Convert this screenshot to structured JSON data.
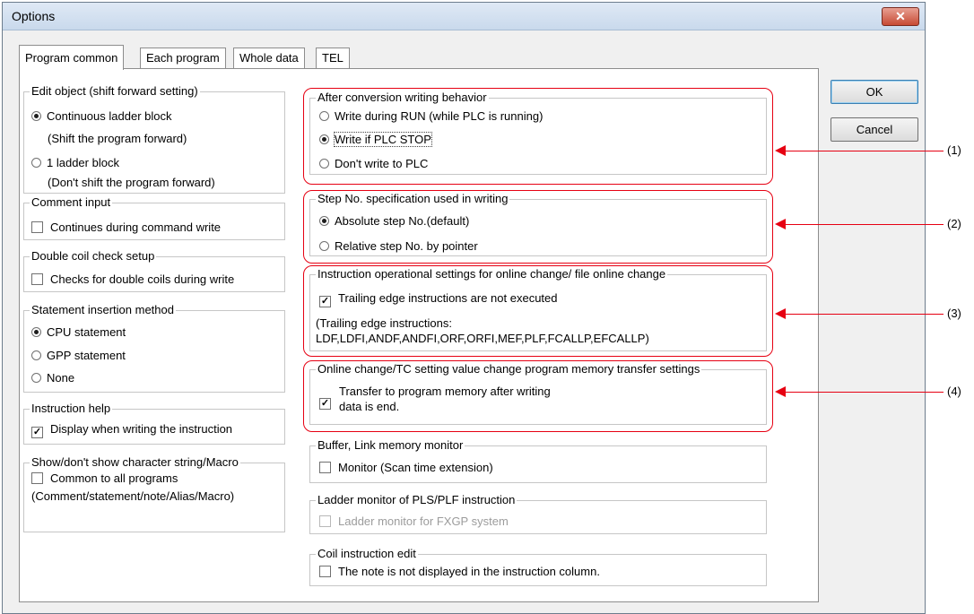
{
  "window": {
    "title": "Options",
    "close_glyph": "✕"
  },
  "tabs": [
    "Program common",
    "Each program",
    "Whole data",
    "TEL"
  ],
  "buttons": {
    "ok": "OK",
    "cancel": "Cancel"
  },
  "left": {
    "edit_object": {
      "legend": "Edit object (shift forward setting)",
      "opt1": "Continuous ladder block",
      "opt1_sub": "(Shift the program forward)",
      "opt2": "1 ladder block",
      "opt2_sub": "(Don't shift the program forward)",
      "selected": 1
    },
    "comment_input": {
      "legend": "Comment input",
      "opt": "Continues during command write",
      "checked": false
    },
    "double_coil": {
      "legend": "Double coil check setup",
      "opt": "Checks for double coils during write",
      "checked": false
    },
    "statement_insertion": {
      "legend": "Statement insertion method",
      "opts": [
        "CPU statement",
        "GPP statement",
        "None"
      ],
      "selected": 1
    },
    "instruction_help": {
      "legend": "Instruction help",
      "opt": "Display when writing the instruction",
      "checked": true
    },
    "show_string": {
      "legend": "Show/don't show character string/Macro",
      "opt": "Common to all programs",
      "sub": "(Comment/statement/note/Alias/Macro)",
      "checked": false
    }
  },
  "right": {
    "after_conversion": {
      "legend": "After conversion writing behavior",
      "opts": [
        "Write during RUN (while PLC is running)",
        "Write if PLC STOP",
        "Don't write to PLC"
      ],
      "selected": 2
    },
    "step_no": {
      "legend": "Step No. specification used in writing",
      "opts": [
        "Absolute step No.(default)",
        "Relative step No. by pointer"
      ],
      "selected": 1
    },
    "instruction_operational": {
      "legend": "Instruction operational settings for online change/ file online change",
      "opt": "Trailing edge instructions are not executed",
      "checked": true,
      "note1": "(Trailing edge instructions:",
      "note2": "LDF,LDFI,ANDF,ANDFI,ORF,ORFI,MEF,PLF,FCALLP,EFCALLP)"
    },
    "online_change": {
      "legend": "Online change/TC setting value change program memory transfer settings",
      "opt_line1": "Transfer to program memory after writing",
      "opt_line2": "data is end.",
      "checked": true
    },
    "buffer_link": {
      "legend": "Buffer, Link memory monitor",
      "opt": "Monitor (Scan time extension)",
      "checked": false
    },
    "ladder_monitor": {
      "legend": "Ladder monitor of PLS/PLF instruction",
      "opt": "Ladder monitor for FXGP system",
      "checked": false,
      "disabled": true
    },
    "coil_edit": {
      "legend": "Coil instruction edit",
      "opt": "The note is not displayed in the instruction column.",
      "checked": false
    }
  },
  "callouts": [
    "(1)",
    "(2)",
    "(3)",
    "(4)"
  ],
  "check_glyph": "✓",
  "colors": {
    "highlight": "#e60012"
  }
}
